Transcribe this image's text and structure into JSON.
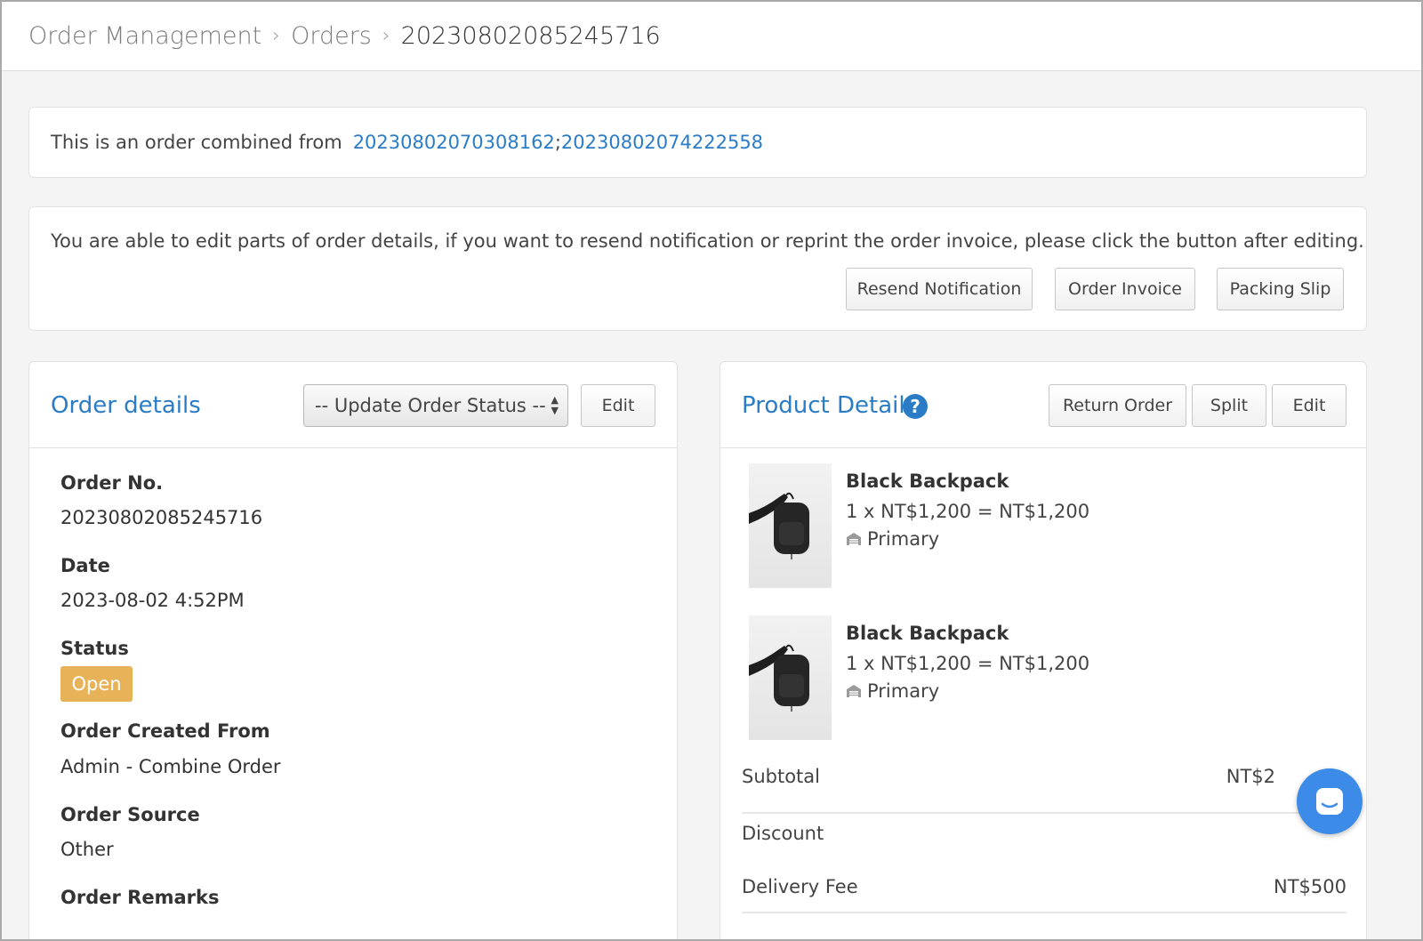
{
  "breadcrumb": {
    "items": [
      "Order Management",
      "Orders"
    ],
    "current": "20230802085245716"
  },
  "combined": {
    "text": "This is an order combined from",
    "orders": [
      "20230802070308162",
      "20230802074222558"
    ],
    "separator": ";"
  },
  "notice": {
    "message": "You are able to edit parts of order details, if you want to resend notification or reprint the order invoice, please click the button after editing.",
    "buttons": {
      "resend": "Resend Notification",
      "invoice": "Order Invoice",
      "packing": "Packing Slip"
    }
  },
  "order_details": {
    "title": "Order details",
    "status_select": "-- Update Order Status --",
    "edit_label": "Edit",
    "fields": {
      "order_no_label": "Order No.",
      "order_no": "20230802085245716",
      "date_label": "Date",
      "date": "2023-08-02 4:52PM",
      "status_label": "Status",
      "status": "Open",
      "created_from_label": "Order Created From",
      "created_from": "Admin - Combine Order",
      "source_label": "Order Source",
      "source": "Other",
      "remarks_label": "Order Remarks"
    }
  },
  "product_details": {
    "title": "Product Details",
    "help_glyph": "?",
    "buttons": {
      "return": "Return Order",
      "split": "Split",
      "edit": "Edit"
    },
    "items": [
      {
        "name": "Black Backpack",
        "price": "1 x NT$1,200 = NT$1,200",
        "location": "Primary"
      },
      {
        "name": "Black Backpack",
        "price": "1 x NT$1,200 = NT$1,200",
        "location": "Primary"
      }
    ],
    "summary": {
      "subtotal_label": "Subtotal",
      "subtotal_value": "NT$2",
      "discount_label": "Discount",
      "delivery_label": "Delivery Fee",
      "delivery_value": "NT$500"
    }
  },
  "colors": {
    "link": "#2b7cc7",
    "status_open": "#e8b259",
    "chat_bubble": "#3d8be8"
  }
}
